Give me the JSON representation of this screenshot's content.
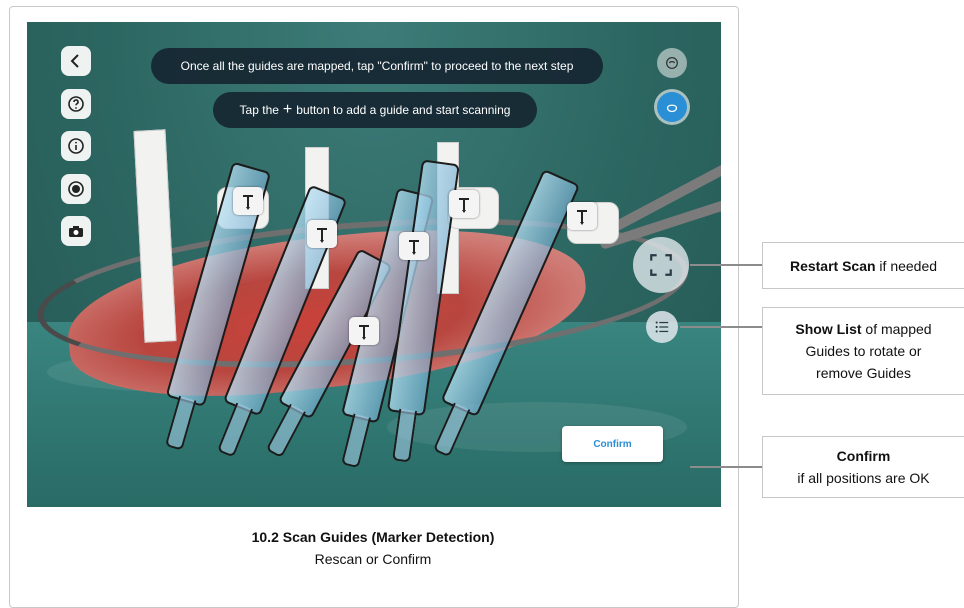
{
  "overlay": {
    "message_top": "Once all the guides are mapped, tap \"Confirm\" to proceed to the next step",
    "message_add_prefix": "Tap the",
    "message_add_symbol": "+",
    "message_add_suffix": "button to add a guide and start scanning"
  },
  "toolbar": {
    "icons": [
      "back-icon",
      "help-icon",
      "info-icon",
      "record-icon",
      "camera-icon"
    ]
  },
  "actions": {
    "confirm_label": "Confirm"
  },
  "caption": {
    "title": "10.2 Scan Guides (Marker Detection)",
    "subtitle": "Rescan or Confirm"
  },
  "callouts": {
    "restart": {
      "bold": "Restart Scan",
      "rest": " if needed"
    },
    "list": {
      "bold": "Show List",
      "rest1": " of mapped",
      "line2": "Guides to rotate or",
      "line3": "remove Guides"
    },
    "confirm": {
      "bold": "Confirm",
      "line2": "if all positions are OK"
    }
  },
  "colors": {
    "accent": "#2b8fd6",
    "drape": "#2c6661",
    "pill_bg": "#162632"
  }
}
